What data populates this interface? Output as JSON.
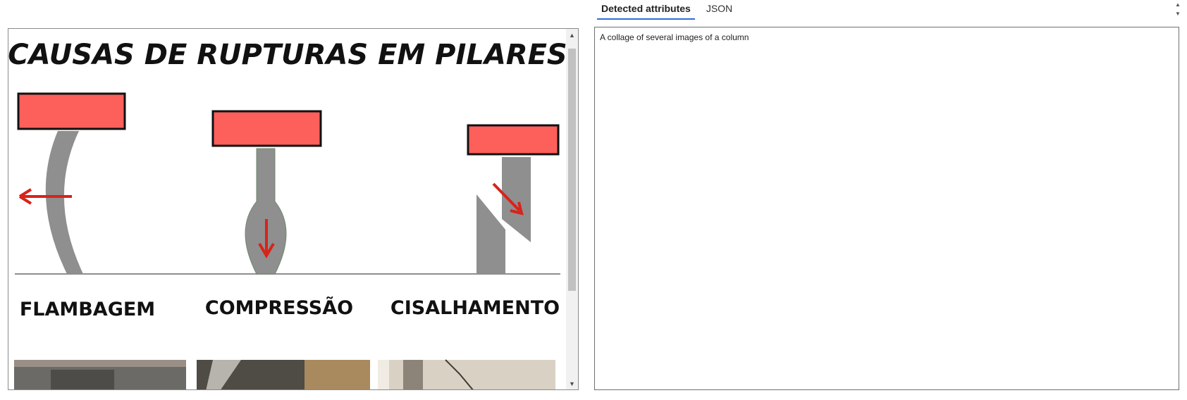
{
  "image": {
    "title": "CAUSAS DE RUPTURAS EM PILARES",
    "labels": [
      "FLAMBAGEM",
      "COMPRESSÃO",
      "CISALHAMENTO"
    ],
    "colors": {
      "cap": "#fd5f5b",
      "column": "#8f8f8f",
      "arrow": "#d8231b",
      "ground": "#8f8f8f"
    }
  },
  "tabs": [
    {
      "label": "Detected attributes",
      "active": true
    },
    {
      "label": "JSON",
      "active": false
    }
  ],
  "attributes": {
    "caption": "A collage of several images of a column"
  }
}
